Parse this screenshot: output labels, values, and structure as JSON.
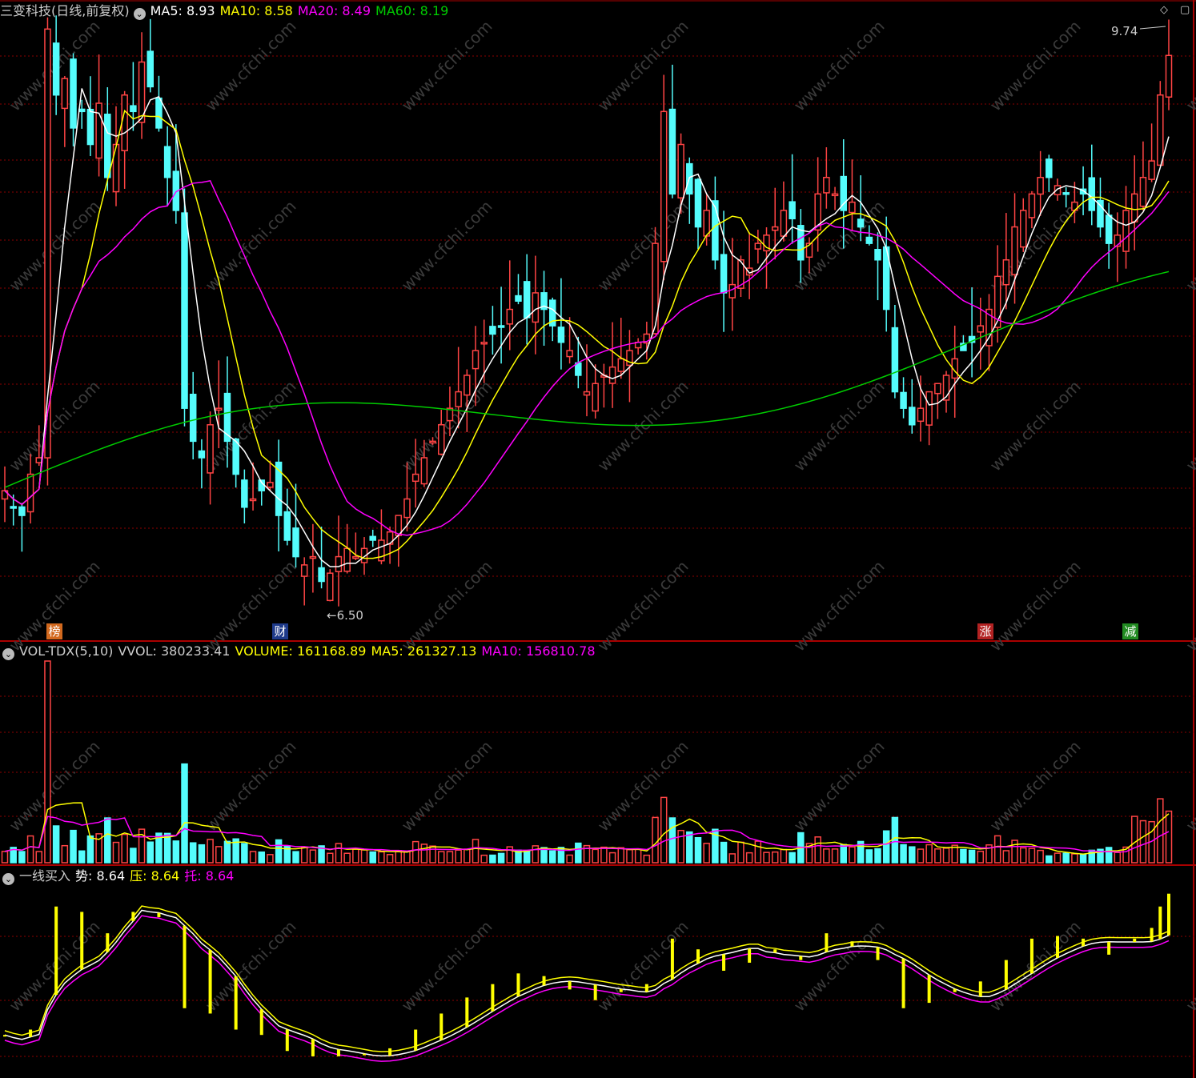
{
  "colors": {
    "bg": "#000000",
    "grid": "#8B0000",
    "up": "#FF4444",
    "down": "#54FCFC",
    "ma5": "#FFFFFF",
    "ma10": "#FFFF00",
    "ma20": "#FF00FF",
    "ma60": "#00CC00"
  },
  "price_header": {
    "title": "三变科技(日线,前复权)",
    "ma5_label": "MA5: 8.93",
    "ma10_label": "MA10: 8.58",
    "ma20_label": "MA20: 8.49",
    "ma60_label": "MA60: 8.19",
    "collapse_icon": "chevron-down-icon"
  },
  "price_annotations": {
    "high": "9.74",
    "low": "6.50"
  },
  "event_flags": [
    {
      "label": "榜",
      "color": "#D2691E"
    },
    {
      "label": "财",
      "color": "#1E3A8A"
    },
    {
      "label": "涨",
      "color": "#B22222"
    },
    {
      "label": "减",
      "color": "#228B22"
    }
  ],
  "volume_header": {
    "name": "VOL-TDX(5,10)",
    "vvol": "VVOL: 380233.41",
    "volume": "VOLUME: 161168.89",
    "ma5": "MA5: 261327.13",
    "ma10": "MA10: 156810.78"
  },
  "indicator_header": {
    "name": "一线买入",
    "shi": "势: 8.64",
    "ya": "压: 8.64",
    "tuo": "托: 8.64"
  },
  "watermark": "www.cfchi.com",
  "chart_data": {
    "type": "candlestick",
    "price_closes": [
      7.1,
      7.0,
      6.95,
      7.2,
      7.3,
      9.9,
      9.5,
      9.6,
      9.3,
      9.4,
      9.2,
      9.45,
      9.0,
      9.2,
      9.5,
      9.4,
      9.7,
      9.55,
      9.3,
      9.0,
      8.8,
      7.6,
      7.4,
      7.3,
      7.5,
      7.6,
      7.4,
      7.2,
      7.0,
      7.05,
      7.1,
      7.15,
      6.95,
      6.8,
      6.7,
      6.65,
      6.7,
      6.55,
      6.6,
      6.7,
      6.75,
      6.7,
      6.75,
      6.8,
      6.8,
      6.85,
      6.95,
      7.05,
      7.2,
      7.3,
      7.4,
      7.5,
      7.6,
      7.7,
      7.8,
      7.95,
      8.0,
      8.05,
      8.1,
      8.2,
      8.25,
      8.15,
      8.3,
      8.2,
      8.1,
      8.0,
      7.95,
      7.8,
      7.7,
      7.75,
      7.8,
      7.85,
      7.9,
      7.95,
      8.0,
      8.05,
      8.6,
      9.4,
      8.9,
      9.2,
      8.9,
      8.7,
      8.8,
      8.5,
      8.3,
      8.35,
      8.5,
      8.45,
      8.6,
      8.65,
      8.7,
      8.8,
      8.75,
      8.5,
      8.6,
      8.9,
      9.0,
      8.9,
      8.8,
      8.85,
      8.7,
      8.6,
      8.5,
      8.2,
      7.7,
      7.6,
      7.5,
      7.6,
      7.7,
      7.75,
      7.8,
      7.9,
      7.95,
      8.0,
      8.1,
      8.2,
      8.4,
      8.5,
      8.7,
      8.8,
      8.9,
      9.0,
      9.0,
      8.95,
      8.9,
      8.85,
      8.9,
      8.8,
      8.7,
      8.6,
      8.65,
      8.8,
      8.9,
      9.0,
      9.1,
      9.5,
      9.74
    ],
    "ma60_series_start": 7.12,
    "ma60_series_end": 8.19,
    "volume_ma5": 261327.13,
    "volume_ma10": 156810.78,
    "vvol": 380233.41,
    "volume_last": 161168.89,
    "indicator_last": 8.64,
    "price_high": 9.74,
    "price_low": 6.5
  }
}
